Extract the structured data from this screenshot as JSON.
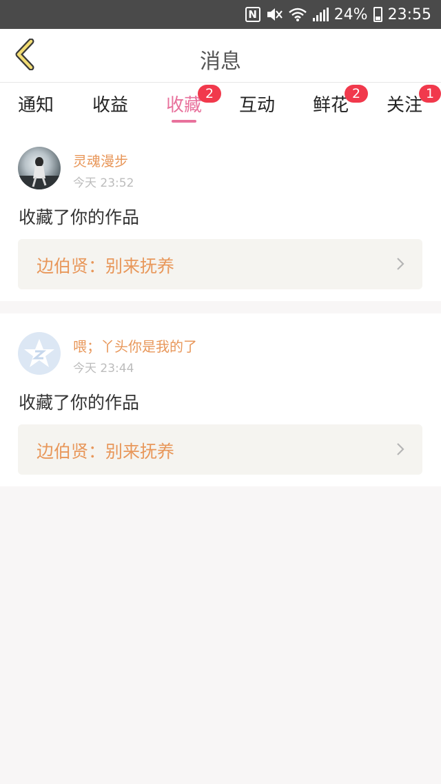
{
  "status_bar": {
    "battery": "24%",
    "time": "23:55",
    "icons": [
      "nfc-icon",
      "mute-icon",
      "wifi-icon",
      "signal-icon",
      "battery-icon"
    ]
  },
  "header": {
    "title": "消息",
    "back_icon": "chevron-left-icon",
    "back_icon_color": "#c9a227"
  },
  "tabs": [
    {
      "label": "通知",
      "badge": ""
    },
    {
      "label": "收益",
      "badge": ""
    },
    {
      "label": "收藏",
      "badge": "2",
      "active": true
    },
    {
      "label": "互动",
      "badge": ""
    },
    {
      "label": "鲜花",
      "badge": "2"
    },
    {
      "label": "关注",
      "badge": "1"
    }
  ],
  "colors": {
    "accent": "#e8719c",
    "name": "#e8975a",
    "badge": "#f1394c"
  },
  "messages": [
    {
      "avatar": "user-photo-avatar",
      "username": "灵魂漫步",
      "time": "今天 23:52",
      "action": "收藏了你的作品",
      "work": "边伯贤：别来抚养"
    },
    {
      "avatar": "default-star-avatar",
      "username": "喂；丫头你是我的了",
      "time": "今天 23:44",
      "action": "收藏了你的作品",
      "work": "边伯贤：别来抚养"
    }
  ]
}
